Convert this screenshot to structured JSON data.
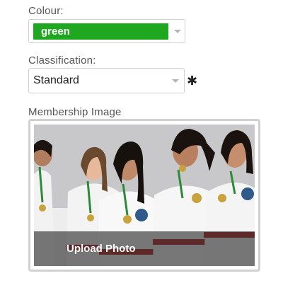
{
  "colour": {
    "label": "Colour:",
    "value": "green",
    "color": "#1fa81f"
  },
  "classification": {
    "label": "Classification:",
    "value": "Standard",
    "required_mark": "✱"
  },
  "membership_image": {
    "label": "Membership Image",
    "upload_label": "Upload Photo"
  },
  "icons": {
    "caret": "chevron-down-icon",
    "required": "asterisk-icon"
  }
}
